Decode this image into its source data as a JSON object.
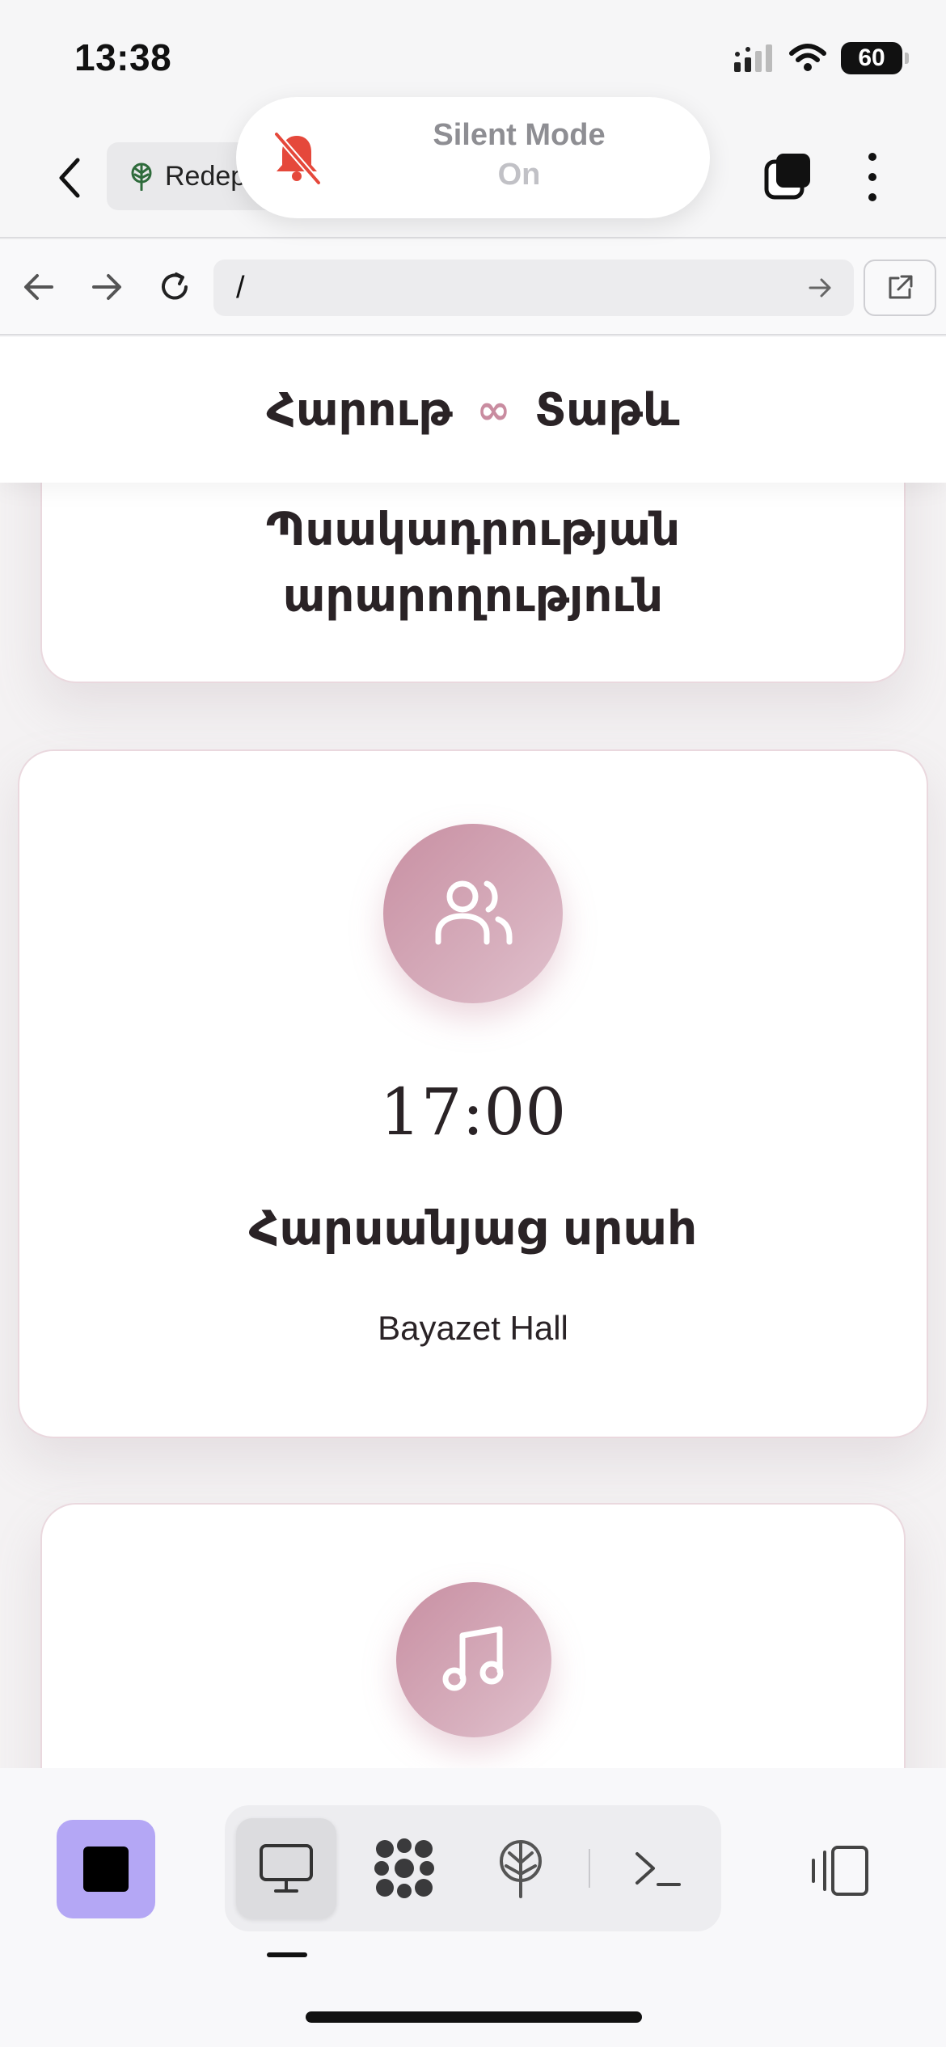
{
  "status_bar": {
    "time": "13:38",
    "battery": "60",
    "icons": [
      "cellular-signal-icon",
      "wifi-icon",
      "battery-icon"
    ]
  },
  "browser": {
    "tab_label": "Redep",
    "tab_icon": "tree-icon",
    "url": "/",
    "icons": [
      "back-chevron-icon",
      "tabs-icon",
      "more-icon",
      "arrow-left-icon",
      "arrow-right-icon",
      "reload-icon",
      "go-arrow-icon",
      "open-external-icon"
    ]
  },
  "silent_mode": {
    "title": "Silent Mode",
    "state": "On",
    "icon": "bell-slash-icon",
    "icon_color": "#e5483b"
  },
  "site": {
    "header": {
      "left": "Հարութ",
      "symbol": "∞",
      "right": "Տաթև",
      "symbol_color": "#c98ca0"
    },
    "cards": [
      {
        "title_line1": "Պսակադրության",
        "title_line2": "արարողություն"
      },
      {
        "icon": "people-icon",
        "time": "17:00",
        "title": "Հարսանյաց սրահ",
        "venue": "Bayazet Hall"
      },
      {
        "icon": "music-note-icon"
      }
    ],
    "accent_gradient": [
      "#c88fa2",
      "#e2c3cf"
    ]
  },
  "toolbar": {
    "stop_color": "#b4a7f5",
    "tools": [
      "desktop-icon",
      "grid-app-icon",
      "tree-icon",
      "terminal-icon"
    ],
    "side_panel_icon": "side-panel-icon"
  }
}
